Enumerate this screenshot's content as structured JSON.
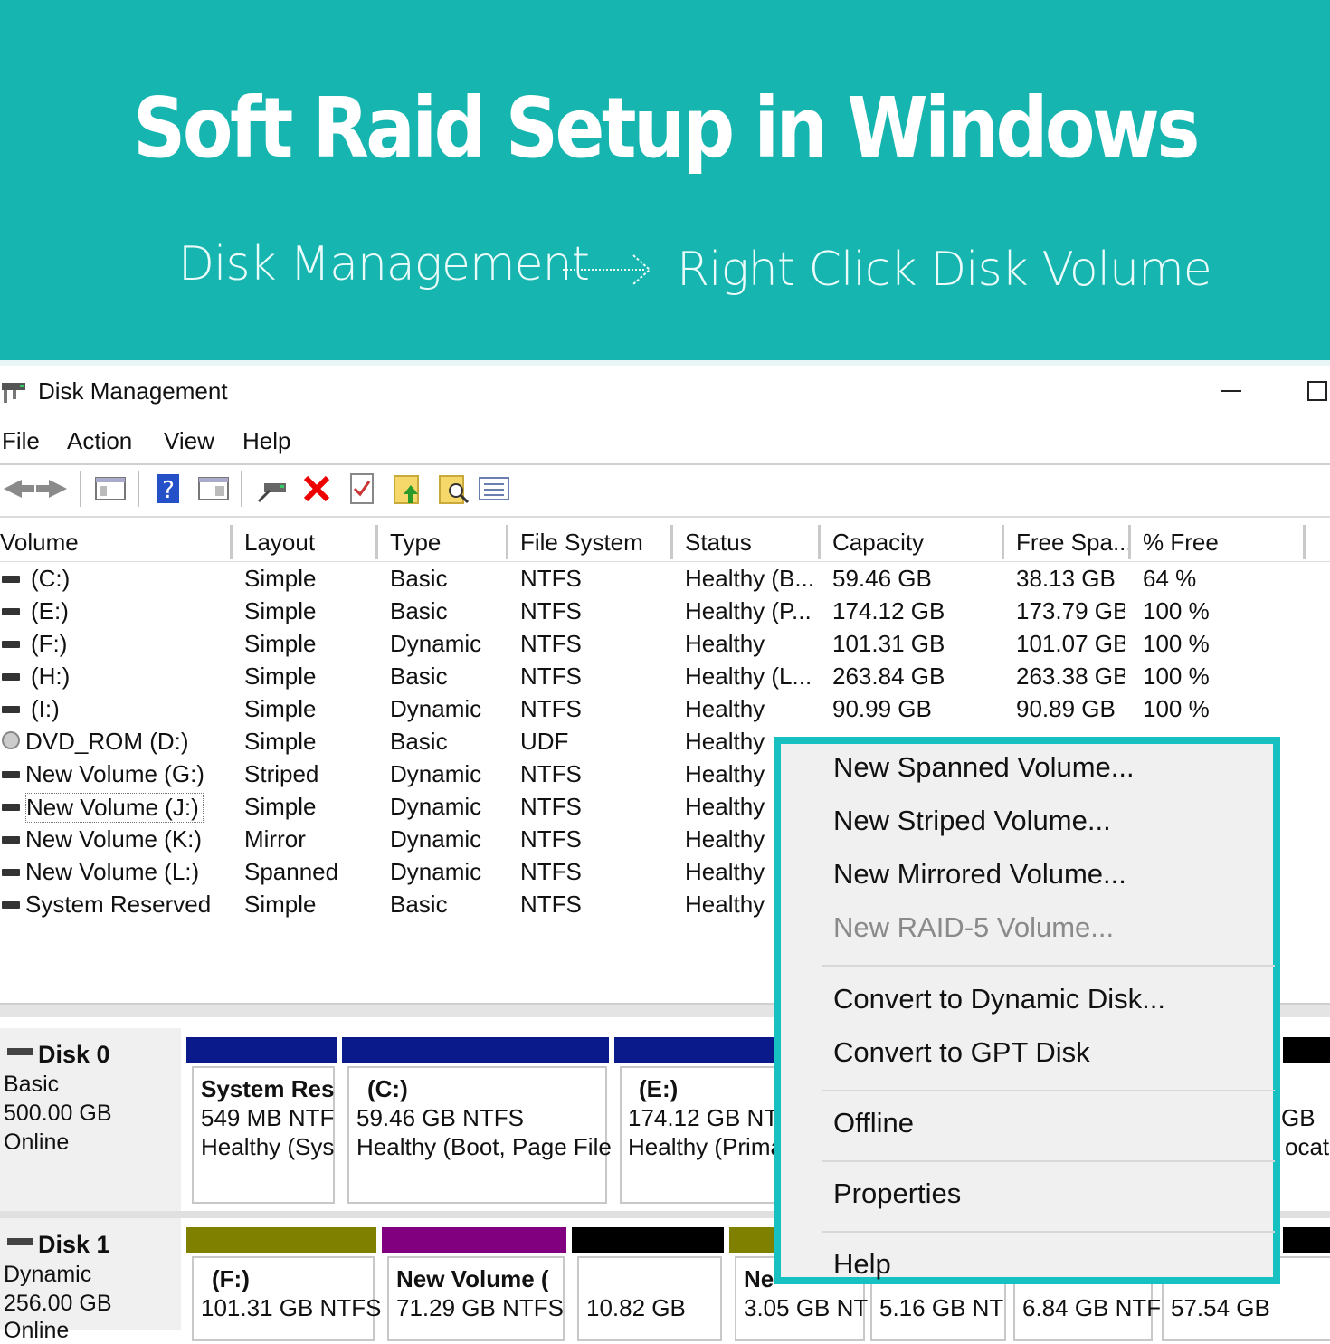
{
  "banner": {
    "title": "Soft Raid Setup in Windows",
    "step1": "Disk Management",
    "step2": "Right Click Disk Volume",
    "bg_color": "#17b5b0"
  },
  "window": {
    "title": "Disk Management",
    "minimize_icon": "minimize-icon",
    "maximize_icon": "maximize-icon"
  },
  "menu": [
    "File",
    "Action",
    "View",
    "Help"
  ],
  "toolbar_icons": [
    "back-arrow-icon",
    "forward-arrow-icon",
    "console-tree-icon",
    "help-icon",
    "properties-pane-icon",
    "connect-drive-icon",
    "delete-icon",
    "check-icon",
    "open-folder-up-icon",
    "search-folder-icon",
    "list-view-icon"
  ],
  "table": {
    "columns": [
      "Volume",
      "Layout",
      "Type",
      "File System",
      "Status",
      "Capacity",
      "Free Spa...",
      "% Free"
    ],
    "rows": [
      [
        "(C:)",
        "Simple",
        "Basic",
        "NTFS",
        "Healthy (B...",
        "59.46 GB",
        "38.13 GB",
        "64 %"
      ],
      [
        "(E:)",
        "Simple",
        "Basic",
        "NTFS",
        "Healthy (P...",
        "174.12 GB",
        "173.79 GB",
        "100 %"
      ],
      [
        "(F:)",
        "Simple",
        "Dynamic",
        "NTFS",
        "Healthy",
        "101.31 GB",
        "101.07 GB",
        "100 %"
      ],
      [
        "(H:)",
        "Simple",
        "Basic",
        "NTFS",
        "Healthy (L...",
        "263.84 GB",
        "263.38 GB",
        "100 %"
      ],
      [
        "(I:)",
        "Simple",
        "Dynamic",
        "NTFS",
        "Healthy",
        "90.99 GB",
        "90.89 GB",
        "100 %"
      ],
      [
        "DVD_ROM (D:)",
        "Simple",
        "Basic",
        "UDF",
        "Healthy",
        "",
        "",
        ""
      ],
      [
        "New Volume (G:)",
        "Striped",
        "Dynamic",
        "NTFS",
        "Healthy",
        "",
        "",
        ""
      ],
      [
        "New Volume (J:)",
        "Simple",
        "Dynamic",
        "NTFS",
        "Healthy",
        "",
        "",
        ""
      ],
      [
        "New Volume (K:)",
        "Mirror",
        "Dynamic",
        "NTFS",
        "Healthy",
        "",
        "",
        ""
      ],
      [
        "New Volume (L:)",
        "Spanned",
        "Dynamic",
        "NTFS",
        "Healthy",
        "",
        "",
        ""
      ],
      [
        "System Reserved",
        "Simple",
        "Basic",
        "NTFS",
        "Healthy",
        "",
        "",
        ""
      ]
    ]
  },
  "disks": [
    {
      "name": "Disk 0",
      "type": "Basic",
      "size": "500.00 GB",
      "state": "Online",
      "partitions": [
        {
          "title": "System Res",
          "line1": "549 MB NTF",
          "line2": "Healthy (Sys",
          "bar_color": "#0a1a8a"
        },
        {
          "title": "(C:)",
          "line1": "59.46 GB NTFS",
          "line2": "Healthy (Boot, Page File",
          "bar_color": "#0a1a8a"
        },
        {
          "title": "(E:)",
          "line1": "174.12 GB NTF",
          "line2": "Healthy (Prima",
          "bar_color": "#0a1a8a"
        },
        {
          "title": "",
          "line1": "GB",
          "line2": "ocat",
          "bar_color": "#000000"
        }
      ]
    },
    {
      "name": "Disk 1",
      "type": "Dynamic",
      "size": "256.00 GB",
      "state": "Online",
      "partitions": [
        {
          "title": "(F:)",
          "line1": "101.31 GB NTFS",
          "bar_color": "#7f7f00"
        },
        {
          "title": "New Volume  (",
          "line1": "71.29 GB NTFS",
          "bar_color": "#800080"
        },
        {
          "title": "",
          "line1": "10.82 GB",
          "bar_color": "#000000"
        },
        {
          "title": "Ne",
          "line1": "3.05 GB NT",
          "bar_color": "#7f7f00"
        },
        {
          "title": "",
          "line1": "5.16 GB NT",
          "bar_color": "#7f7f00"
        },
        {
          "title": "",
          "line1": "6.84 GB NTF",
          "bar_color": "#7f7f00"
        },
        {
          "title": "",
          "line1": "57.54 GB",
          "bar_color": "#000000"
        }
      ]
    }
  ],
  "context_menu": {
    "items": [
      {
        "label": "New Spanned Volume...",
        "enabled": true
      },
      {
        "label": "New Striped Volume...",
        "enabled": true
      },
      {
        "label": "New Mirrored Volume...",
        "enabled": true
      },
      {
        "label": "New RAID-5 Volume...",
        "enabled": false
      },
      {
        "label": "Convert to Dynamic Disk...",
        "enabled": true
      },
      {
        "label": "Convert to GPT Disk",
        "enabled": true
      },
      {
        "label": "Offline",
        "enabled": true
      },
      {
        "label": "Properties",
        "enabled": true
      },
      {
        "label": "Help",
        "enabled": true
      }
    ],
    "border_color": "#17c1c1"
  }
}
